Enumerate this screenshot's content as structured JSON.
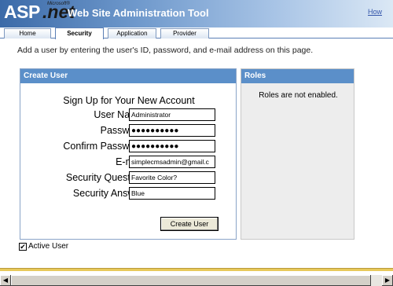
{
  "header": {
    "logo_main": "ASP",
    "logo_net": ".net",
    "logo_microsoft": "Microsoft®",
    "title": "Web Site Administration Tool",
    "help_link": "How"
  },
  "tabs": [
    {
      "label": "Home",
      "active": false
    },
    {
      "label": "Security",
      "active": true
    },
    {
      "label": "Application",
      "active": false
    },
    {
      "label": "Provider",
      "active": false
    }
  ],
  "intro": "Add a user by entering the user's ID, password, and e-mail address on this page.",
  "create_user": {
    "heading": "Create User",
    "form_title": "Sign Up for Your New Account",
    "fields": [
      {
        "label": "User Name:",
        "value": "Administrator",
        "type": "text"
      },
      {
        "label": "Password:",
        "value": "●●●●●●●●●●",
        "type": "password"
      },
      {
        "label": "Confirm Password:",
        "value": "●●●●●●●●●●",
        "type": "password"
      },
      {
        "label": "E-mail:",
        "value": "simplecmsadmin@gmail.c",
        "type": "text"
      },
      {
        "label": "Security Question:",
        "value": "Favorite Color?",
        "type": "text"
      },
      {
        "label": "Security Answer:",
        "value": "Blue",
        "type": "text"
      }
    ],
    "submit_label": "Create User"
  },
  "roles": {
    "heading": "Roles",
    "message": "Roles are not enabled."
  },
  "active_user": {
    "label": "Active User",
    "checked": true,
    "check_glyph": "✔"
  },
  "scrollbar": {
    "left_icon": "arrow-left-icon",
    "right_icon": "arrow-right-icon"
  },
  "colors": {
    "header_start": "#3b6aa8",
    "panel_header": "#5b8fc9",
    "footer_rule": "#e8c95a"
  }
}
